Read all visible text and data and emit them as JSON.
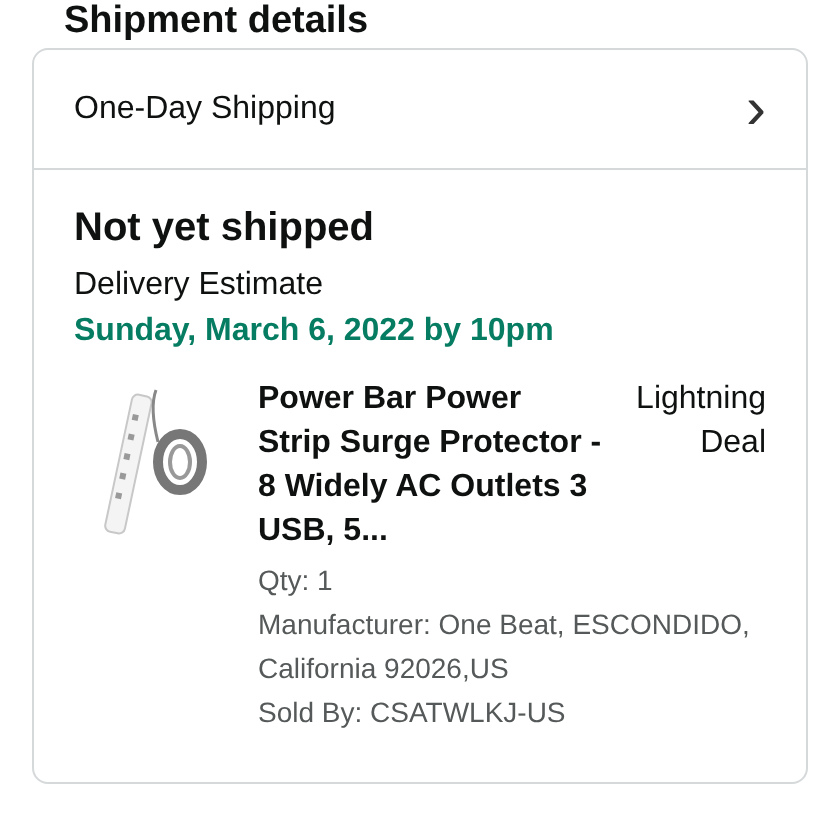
{
  "page_title": "Shipment details",
  "shipping_option": {
    "label": "One-Day Shipping",
    "chevron": "›"
  },
  "shipment": {
    "status": "Not yet shipped",
    "estimate_label": "Delivery Estimate",
    "estimate_date": "Sunday, March 6, 2022 by 10pm"
  },
  "item": {
    "title": "Power Bar Power Strip Surge Protector - 8 Widely AC Outlets 3 USB, 5...",
    "badge": "Lightning Deal",
    "details": [
      "Qty: 1",
      "Manufacturer: One Beat, ESCONDIDO, California 92026,US",
      "Sold By: CSATWLKJ-US"
    ]
  }
}
